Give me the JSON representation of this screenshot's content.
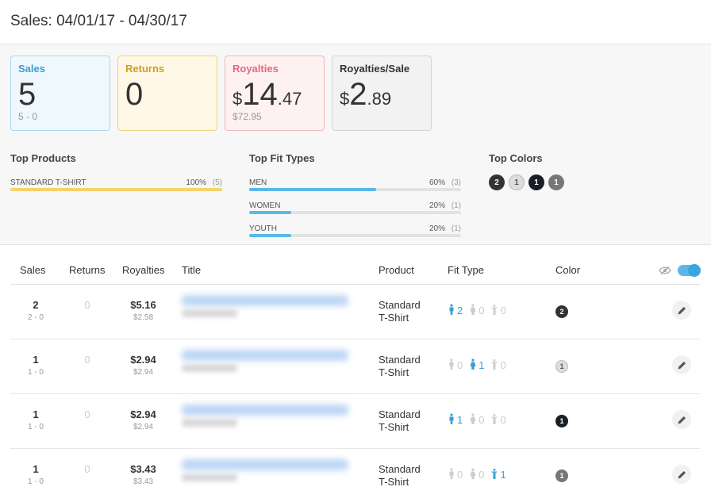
{
  "header": {
    "title": "Sales: 04/01/17 - 04/30/17"
  },
  "cards": {
    "sales": {
      "label": "Sales",
      "value": "5",
      "sub": "5 - 0"
    },
    "returns": {
      "label": "Returns",
      "value": "0"
    },
    "royalties": {
      "label": "Royalties",
      "currency": "$",
      "whole": "14",
      "decimal": ".47",
      "sub": "$72.95"
    },
    "royalties_per_sale": {
      "label": "Royalties/Sale",
      "currency": "$",
      "whole": "2",
      "decimal": ".89"
    }
  },
  "top_products": {
    "title": "Top Products",
    "items": [
      {
        "name": "STANDARD T-SHIRT",
        "percent": "100%",
        "count": "(5)",
        "fraction": 1.0
      }
    ]
  },
  "top_fit_types": {
    "title": "Top Fit Types",
    "items": [
      {
        "name": "MEN",
        "percent": "60%",
        "count": "(3)",
        "fraction": 0.6
      },
      {
        "name": "WOMEN",
        "percent": "20%",
        "count": "(1)",
        "fraction": 0.2
      },
      {
        "name": "YOUTH",
        "percent": "20%",
        "count": "(1)",
        "fraction": 0.2
      }
    ]
  },
  "top_colors": {
    "title": "Top Colors",
    "items": [
      {
        "count": "2",
        "bg": "#333333",
        "fg": "#ffffff"
      },
      {
        "count": "1",
        "bg": "#dddddd",
        "fg": "#555555"
      },
      {
        "count": "1",
        "bg": "#1a1f26",
        "fg": "#ffffff"
      },
      {
        "count": "1",
        "bg": "#777777",
        "fg": "#ffffff"
      }
    ]
  },
  "colors": {
    "blue": "#3a9fd0",
    "yellow": "#f5d36b",
    "bar_blue": "#5ab8e8"
  },
  "table": {
    "headers": {
      "sales": "Sales",
      "returns": "Returns",
      "royalties": "Royalties",
      "title": "Title",
      "product": "Product",
      "fit_type": "Fit Type",
      "color": "Color"
    },
    "rows": [
      {
        "sales": "2",
        "sales_sub": "2 - 0",
        "returns": "0",
        "royalty": "$5.16",
        "royalty_sub": "$2.58",
        "product_line1": "Standard",
        "product_line2": "T-Shirt",
        "fit": [
          "2",
          "0",
          "0"
        ],
        "fit_active": [
          true,
          false,
          false
        ],
        "color_count": "2",
        "color_bg": "#333333",
        "color_fg": "#ffffff"
      },
      {
        "sales": "1",
        "sales_sub": "1 - 0",
        "returns": "0",
        "royalty": "$2.94",
        "royalty_sub": "$2.94",
        "product_line1": "Standard",
        "product_line2": "T-Shirt",
        "fit": [
          "0",
          "1",
          "0"
        ],
        "fit_active": [
          false,
          true,
          false
        ],
        "color_count": "1",
        "color_bg": "#dddddd",
        "color_fg": "#555555"
      },
      {
        "sales": "1",
        "sales_sub": "1 - 0",
        "returns": "0",
        "royalty": "$2.94",
        "royalty_sub": "$2.94",
        "product_line1": "Standard",
        "product_line2": "T-Shirt",
        "fit": [
          "1",
          "0",
          "0"
        ],
        "fit_active": [
          true,
          false,
          false
        ],
        "color_count": "1",
        "color_bg": "#1a1f26",
        "color_fg": "#ffffff"
      },
      {
        "sales": "1",
        "sales_sub": "1 - 0",
        "returns": "0",
        "royalty": "$3.43",
        "royalty_sub": "$3.43",
        "product_line1": "Standard",
        "product_line2": "T-Shirt",
        "fit": [
          "0",
          "0",
          "1"
        ],
        "fit_active": [
          false,
          false,
          true
        ],
        "color_count": "1",
        "color_bg": "#777777",
        "color_fg": "#ffffff"
      }
    ]
  }
}
